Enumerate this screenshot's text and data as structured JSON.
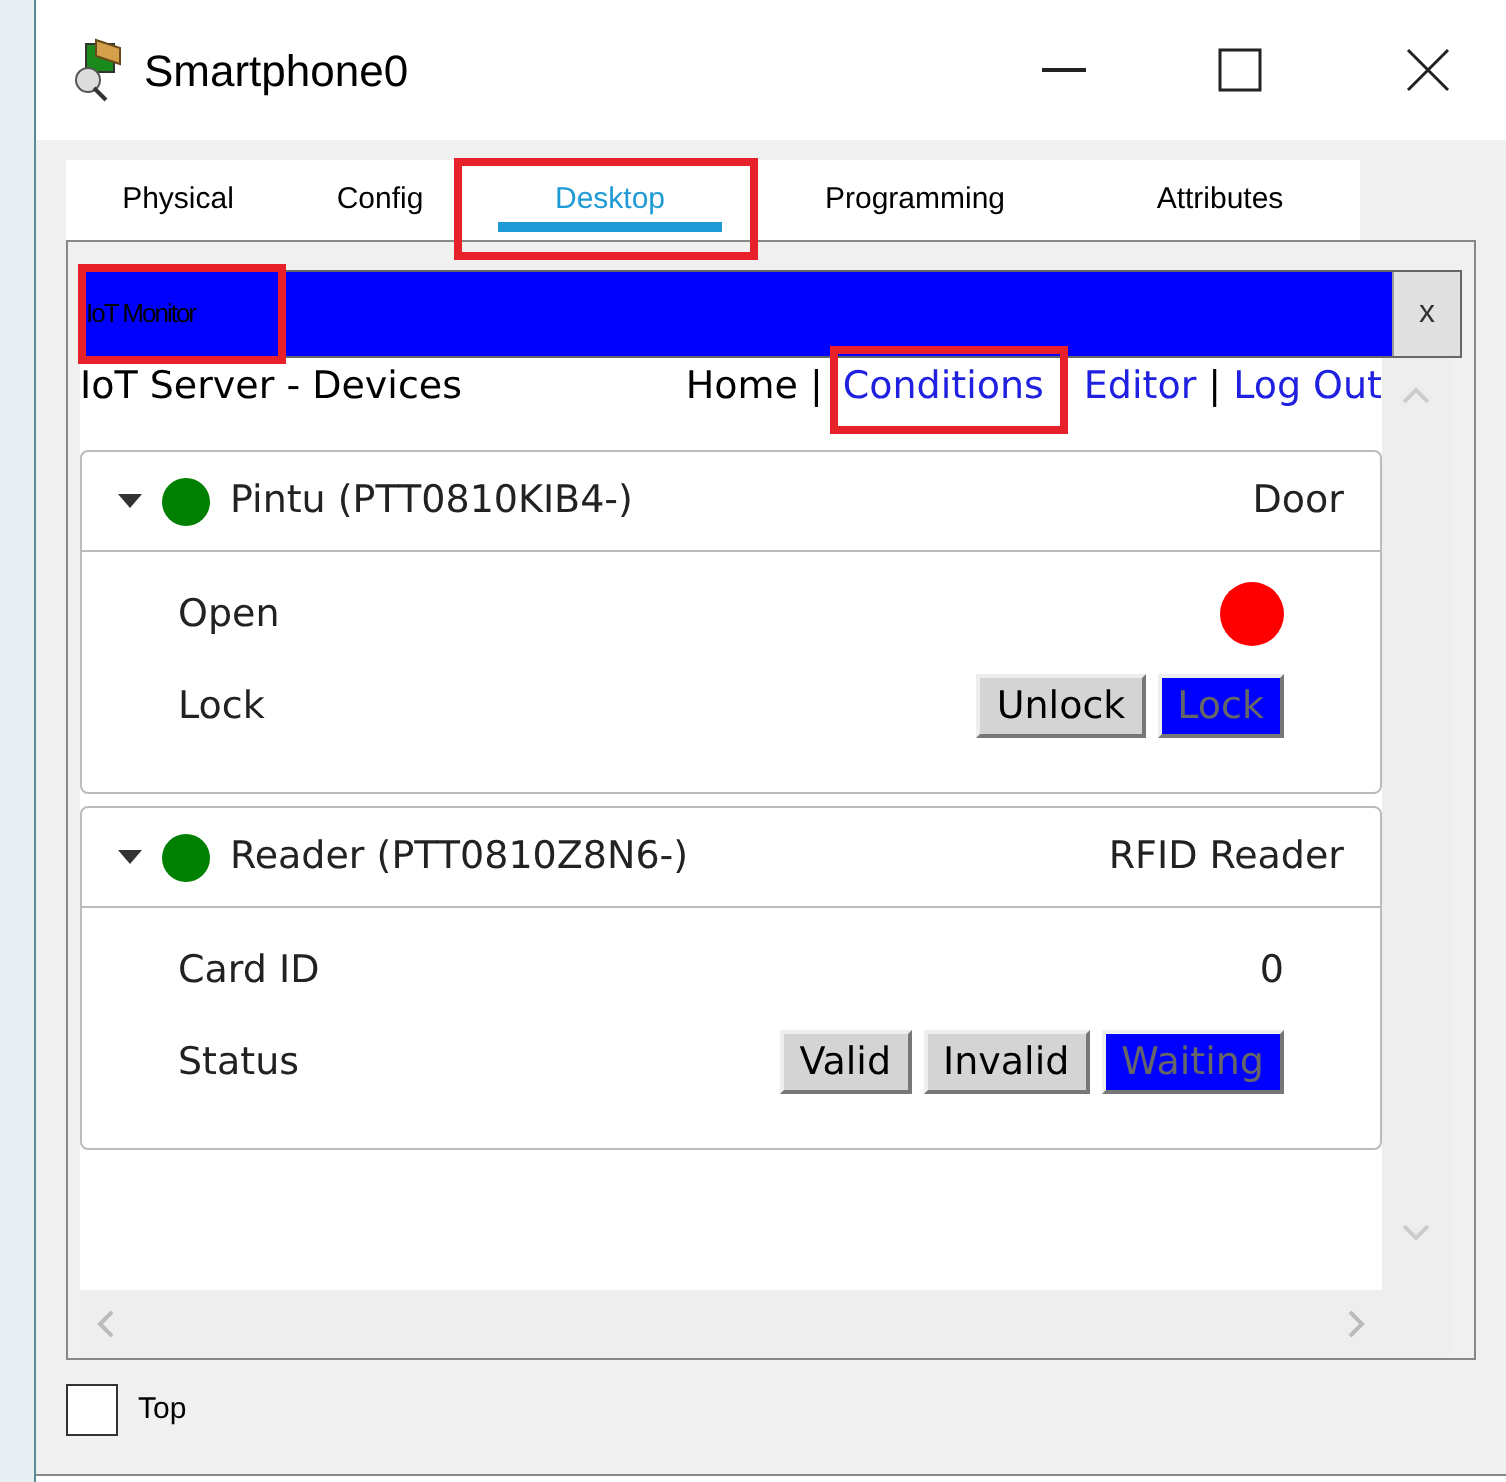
{
  "window": {
    "title": "Smartphone0"
  },
  "tabs": [
    {
      "label": "Physical",
      "selected": false,
      "highlighted": false
    },
    {
      "label": "Config",
      "selected": false,
      "highlighted": false
    },
    {
      "label": "Desktop",
      "selected": true,
      "highlighted": true
    },
    {
      "label": "Programming",
      "selected": false,
      "highlighted": false
    },
    {
      "label": "Attributes",
      "selected": false,
      "highlighted": false
    }
  ],
  "app": {
    "title": "IoT Monitor",
    "title_highlighted": true,
    "close": "x"
  },
  "header": {
    "title": "IoT Server - Devices",
    "nav": [
      {
        "label": "Home",
        "kind": "plain",
        "highlighted": false
      },
      {
        "label": "|",
        "kind": "separator",
        "highlighted": false
      },
      {
        "label": "Conditions",
        "kind": "link",
        "highlighted": true
      },
      {
        "label": "Editor",
        "kind": "link",
        "highlighted": false
      },
      {
        "label": "|",
        "kind": "separator",
        "highlighted": false
      },
      {
        "label": "Log Out",
        "kind": "link",
        "highlighted": false
      }
    ]
  },
  "devices": [
    {
      "name": "Pintu (PTT0810KIB4-)",
      "type": "Door",
      "color": "#008000",
      "expanded": true,
      "rows": [
        {
          "kind": "led",
          "label": "Open",
          "color": "#ff0000"
        },
        {
          "kind": "buttons",
          "label": "Lock",
          "buttons": [
            {
              "label": "Unlock",
              "selected": false
            },
            {
              "label": "Lock",
              "selected": true
            }
          ]
        }
      ]
    },
    {
      "name": "Reader (PTT0810Z8N6-)",
      "type": "RFID Reader",
      "color": "#008000",
      "expanded": true,
      "rows": [
        {
          "kind": "value",
          "label": "Card ID",
          "value": "0"
        },
        {
          "kind": "buttons",
          "label": "Status",
          "buttons": [
            {
              "label": "Valid",
              "selected": false
            },
            {
              "label": "Invalid",
              "selected": false
            },
            {
              "label": "Waiting",
              "selected": true
            }
          ]
        }
      ]
    }
  ],
  "top_checkbox": {
    "label": "Top",
    "checked": false
  }
}
